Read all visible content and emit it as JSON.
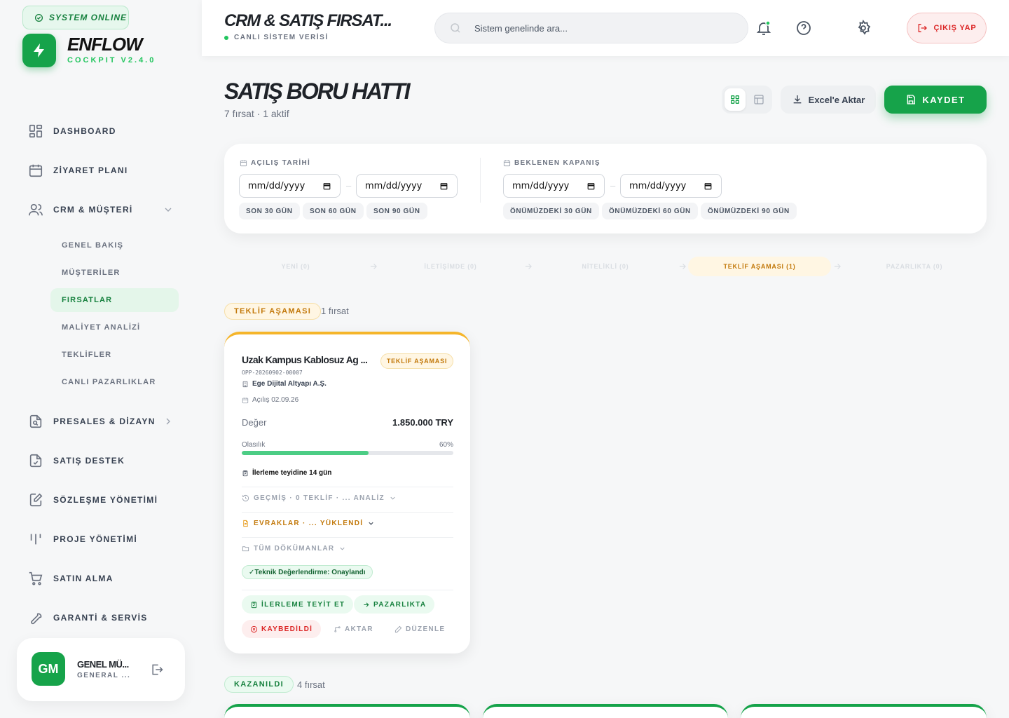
{
  "system_status": "SYSTEM ONLINE",
  "brand": {
    "name": "ENFLOW",
    "version": "COCKPIT V2.4.0"
  },
  "nav": {
    "items": [
      {
        "label": "DASHBOARD",
        "icon": "dashboard-icon"
      },
      {
        "label": "ZİYARET PLANI",
        "icon": "calendar-icon"
      },
      {
        "label": "CRM & MÜŞTERİ",
        "icon": "users-icon"
      },
      {
        "label": "PRESALES & DİZAYN",
        "icon": "file-search-icon"
      },
      {
        "label": "SATIŞ DESTEK",
        "icon": "file-check-icon"
      },
      {
        "label": "SÖZLEŞME YÖNETİMİ",
        "icon": "file-edit-icon"
      },
      {
        "label": "PROJE YÖNETİMİ",
        "icon": "kanban-icon"
      },
      {
        "label": "SATIN ALMA",
        "icon": "cart-icon"
      },
      {
        "label": "GARANTİ & SERVİS",
        "icon": "wrench-icon"
      }
    ],
    "crm_sub": [
      "GENEL BAKIŞ",
      "MÜŞTERİLER",
      "FIRSATLAR",
      "MALİYET ANALİZİ",
      "TEKLİFLER",
      "CANLI PAZARLIKLAR"
    ],
    "active_sub": "FIRSATLAR"
  },
  "user": {
    "initials": "GM",
    "name": "GENEL MÜ...",
    "role": "GENERAL ..."
  },
  "header": {
    "title": "CRM & SATIŞ FIRSAT...",
    "subtitle": "CANLI SİSTEM VERİSİ",
    "search_placeholder": "Sistem genelinde ara...",
    "logout_label": "ÇIKIŞ YAP"
  },
  "page": {
    "title": "SATIŞ BORU HATTI",
    "subtitle": "7 fırsat · 1 aktif",
    "export_label": "Excel'e Aktar",
    "save_label": "KAYDET"
  },
  "filters": {
    "opening": {
      "label": "AÇILIŞ TARİHİ",
      "from_placeholder": "mm/dd/yyyy",
      "to_placeholder": "mm/dd/yyyy",
      "quick": [
        "SON 30 GÜN",
        "SON 60 GÜN",
        "SON 90 GÜN"
      ]
    },
    "closing": {
      "label": "BEKLENEN KAPANIŞ",
      "from_placeholder": "mm/dd/yyyy",
      "to_placeholder": "mm/dd/yyyy",
      "quick": [
        "ÖNÜMÜZDEKİ 30 GÜN",
        "ÖNÜMÜZDEKİ 60 GÜN",
        "ÖNÜMÜZDEKİ 90 GÜN"
      ]
    }
  },
  "stages": [
    {
      "label": "YENİ (0)",
      "active": false
    },
    {
      "label": "İLETİŞİMDE (0)",
      "active": false
    },
    {
      "label": "NİTELİKLİ (0)",
      "active": false
    },
    {
      "label": "TEKLİF AŞAMASI (1)",
      "active": true
    },
    {
      "label": "PAZARLIKTA (0)",
      "active": false
    }
  ],
  "groups": [
    {
      "label": "TEKLİF AŞAMASI",
      "count": "1 fırsat",
      "color": "#c2780a"
    },
    {
      "label": "KAZANILDI",
      "count": "4 fırsat",
      "color": "#15803d"
    }
  ],
  "card": {
    "title": "Uzak Kampus Kablosuz Ag ...",
    "badge": "TEKLİF AŞAMASI",
    "code": "OPP-20260902-00007",
    "company": "Ege Dijital Altyapı A.Ş.",
    "opened": "Açılış 02.09.26",
    "value_label": "Değer",
    "value": "1.850.000 TRY",
    "prob_label": "Olasılık",
    "prob_text": "60%",
    "probability": 0.6,
    "followup": "İlerleme teyidine 14 gün",
    "history": "GEÇMİŞ · 0 TEKLİF · ... ANALİZ",
    "documents": "EVRAKLAR · ... YÜKLENDİ",
    "all_docs": "TÜM DÖKÜMANLAR",
    "tech_tag": "✓Teknik Değerlendirme: Onaylandı",
    "actions": {
      "confirm": "İLERLEME TEYİT ET",
      "negotiate": "PAZARLIKTA",
      "lost": "KAYBEDİLDİ",
      "transfer": "AKTAR",
      "edit": "DÜZENLE"
    }
  },
  "colors": {
    "accent": "#16a34a",
    "warning": "#c2780a",
    "danger": "#dc2626"
  }
}
